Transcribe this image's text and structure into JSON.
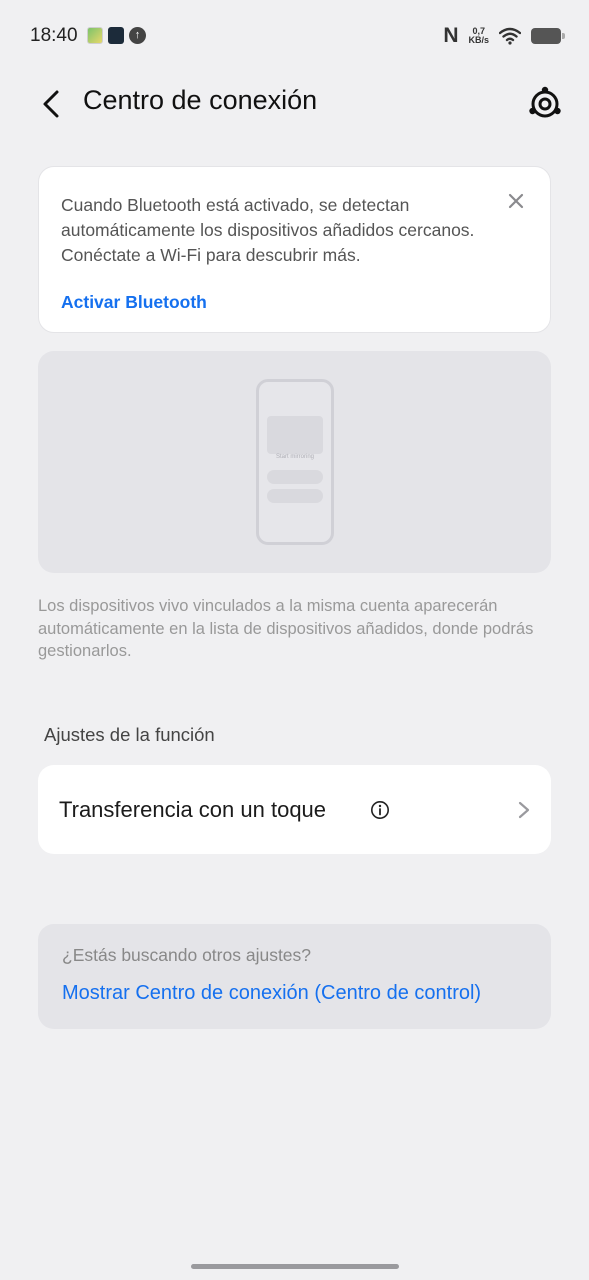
{
  "status_bar": {
    "time": "18:40",
    "notification_icons": [
      "gallery-icon",
      "app-icon",
      "upload-icon"
    ],
    "nfc": "N",
    "net_speed_value": "0,7",
    "net_speed_unit": "KB/s",
    "icons": [
      "nfc-icon",
      "wifi-icon",
      "battery-icon"
    ]
  },
  "header": {
    "title": "Centro de conexión",
    "back_icon": "chevron-left-icon",
    "settings_icon": "settings-icon"
  },
  "bluetooth_card": {
    "message": "Cuando Bluetooth está activado, se detectan automáticamente los dispositivos añadidos cercanos. Conéctate a Wi-Fi para descubrir más.",
    "action_label": "Activar Bluetooth",
    "close_icon": "close-icon"
  },
  "illustration": {
    "phone_text": "Start mirroring",
    "description": "Los dispositivos vivo vinculados a la misma cuenta aparecerán automáticamente en la lista de dispositivos añadidos, donde podrás gestionarlos."
  },
  "feature_settings": {
    "header": "Ajustes de la función",
    "items": [
      {
        "label": "Transferencia con un toque",
        "info_icon": "info-icon",
        "chevron_icon": "chevron-right-icon"
      }
    ]
  },
  "other_settings": {
    "title": "¿Estás buscando otros ajustes?",
    "link": "Mostrar Centro de conexión (Centro de control)"
  },
  "colors": {
    "background": "#f0f0f2",
    "card": "#ffffff",
    "accent": "#1570ef",
    "muted_text": "#999999"
  }
}
